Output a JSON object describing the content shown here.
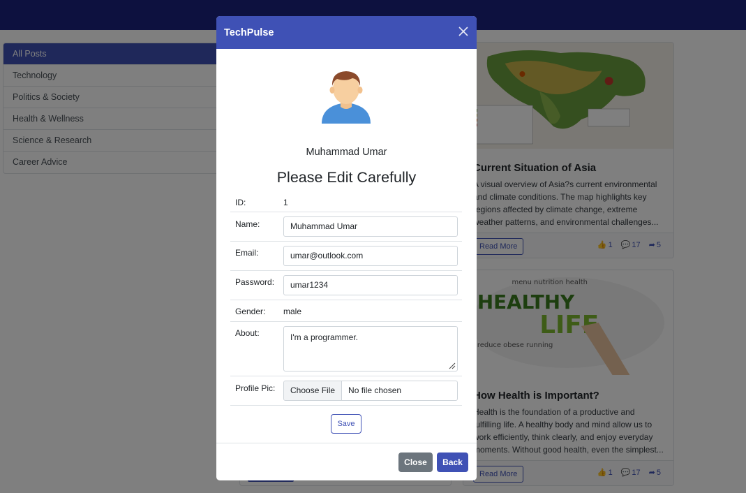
{
  "sidebar": {
    "categories": [
      "All Posts",
      "Technology",
      "Politics & Society",
      "Health & Wellness",
      "Science & Research",
      "Career Advice"
    ]
  },
  "posts": [
    {
      "title": "Current Situation of Asia",
      "text": "A visual overview of Asia?s current environmental and climate conditions. The map highlights key regions affected by climate change, extreme weather patterns, and environmental challenges...",
      "read_more": "Read More",
      "likes": "1",
      "comments": "17",
      "shares": "5"
    },
    {
      "title": "How Health is Important?",
      "text": "Health is the foundation of a productive and fulfilling life. A healthy body and mind allow us to work efficiently, think clearly, and enjoy everyday moments. Without good health, even the simplest...",
      "read_more": "Read More",
      "likes": "1",
      "comments": "17",
      "shares": "5"
    }
  ],
  "modal": {
    "title": "TechPulse",
    "user_name": "Muhammad Umar",
    "heading": "Please Edit Carefully",
    "fields": {
      "id_label": "ID:",
      "id_value": "1",
      "name_label": "Name:",
      "name_value": "Muhammad Umar",
      "email_label": "Email:",
      "email_value": "umar@outlook.com",
      "password_label": "Password:",
      "password_value": "umar1234",
      "gender_label": "Gender:",
      "gender_value": "male",
      "about_label": "About:",
      "about_value": "I'm a programmer.",
      "pic_label": "Profile Pic:",
      "file_button": "Choose File",
      "file_status": "No file chosen"
    },
    "save_label": "Save",
    "close_label": "Close",
    "back_label": "Back"
  },
  "colors": {
    "primary": "#3f51b5",
    "navbar": "#1a237e",
    "secondary": "#6c757d"
  }
}
